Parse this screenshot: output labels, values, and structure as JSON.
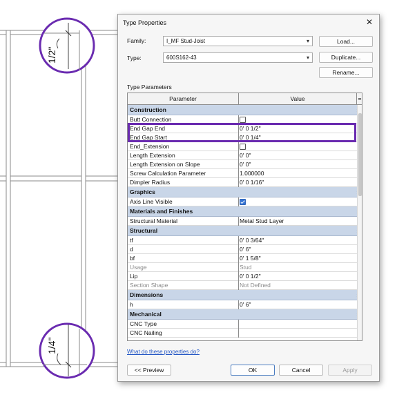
{
  "dialog": {
    "title": "Type Properties",
    "close_glyph": "✕",
    "family_label": "Family:",
    "family_value": "I_MF Stud-Joist",
    "type_label": "Type:",
    "type_value": "600S162-43",
    "load_button": "Load...",
    "duplicate_button": "Duplicate...",
    "rename_button": "Rename...",
    "type_parameters_label": "Type Parameters",
    "columns": {
      "parameter": "Parameter",
      "value": "Value",
      "extra": "="
    },
    "sections": [
      {
        "name": "Construction",
        "rows": [
          {
            "param": "Butt Connection",
            "value": "",
            "checkbox": true,
            "checked": false
          },
          {
            "param": "End Gap End",
            "value": "0'  0 1/2\""
          },
          {
            "param": "End Gap Start",
            "value": "0'  0 1/4\""
          },
          {
            "param": "End_Extension",
            "value": "",
            "checkbox": true,
            "checked": false
          },
          {
            "param": "Length Extension",
            "value": "0'  0\""
          },
          {
            "param": "Length Extension on Slope",
            "value": "0'  0\""
          },
          {
            "param": "Screw Calculation Parameter",
            "value": "1.000000"
          },
          {
            "param": "Dimpler Radius",
            "value": "0'  0 1/16\""
          }
        ]
      },
      {
        "name": "Graphics",
        "rows": [
          {
            "param": "Axis Line Visible",
            "value": "",
            "checkbox": true,
            "checked": true
          }
        ]
      },
      {
        "name": "Materials and Finishes",
        "rows": [
          {
            "param": "Structural Material",
            "value": "Metal Stud Layer"
          }
        ]
      },
      {
        "name": "Structural",
        "rows": [
          {
            "param": "tf",
            "value": "0'  0 3/64\""
          },
          {
            "param": "d",
            "value": "0'  6\""
          },
          {
            "param": "bf",
            "value": "0'  1 5/8\""
          },
          {
            "param": "Usage",
            "value": "Stud",
            "dim": true
          },
          {
            "param": "Lip",
            "value": "0'  0 1/2\""
          },
          {
            "param": "Section Shape",
            "value": "Not Defined",
            "dim": true
          }
        ]
      },
      {
        "name": "Dimensions",
        "rows": [
          {
            "param": "h",
            "value": "0'  6\""
          }
        ]
      },
      {
        "name": "Mechanical",
        "rows": [
          {
            "param": "CNC Type",
            "value": ""
          },
          {
            "param": "CNC Nailing",
            "value": ""
          }
        ]
      }
    ],
    "collapse_glyph": "»",
    "help_link": "What do these properties do?",
    "preview_button": "<< Preview",
    "ok_button": "OK",
    "cancel_button": "Cancel",
    "apply_button": "Apply"
  },
  "background": {
    "callout_top": "1/2\"",
    "callout_bottom": "1/4\"",
    "stud_color": "#8a8a8a",
    "callout_color": "#6a2bb0"
  }
}
